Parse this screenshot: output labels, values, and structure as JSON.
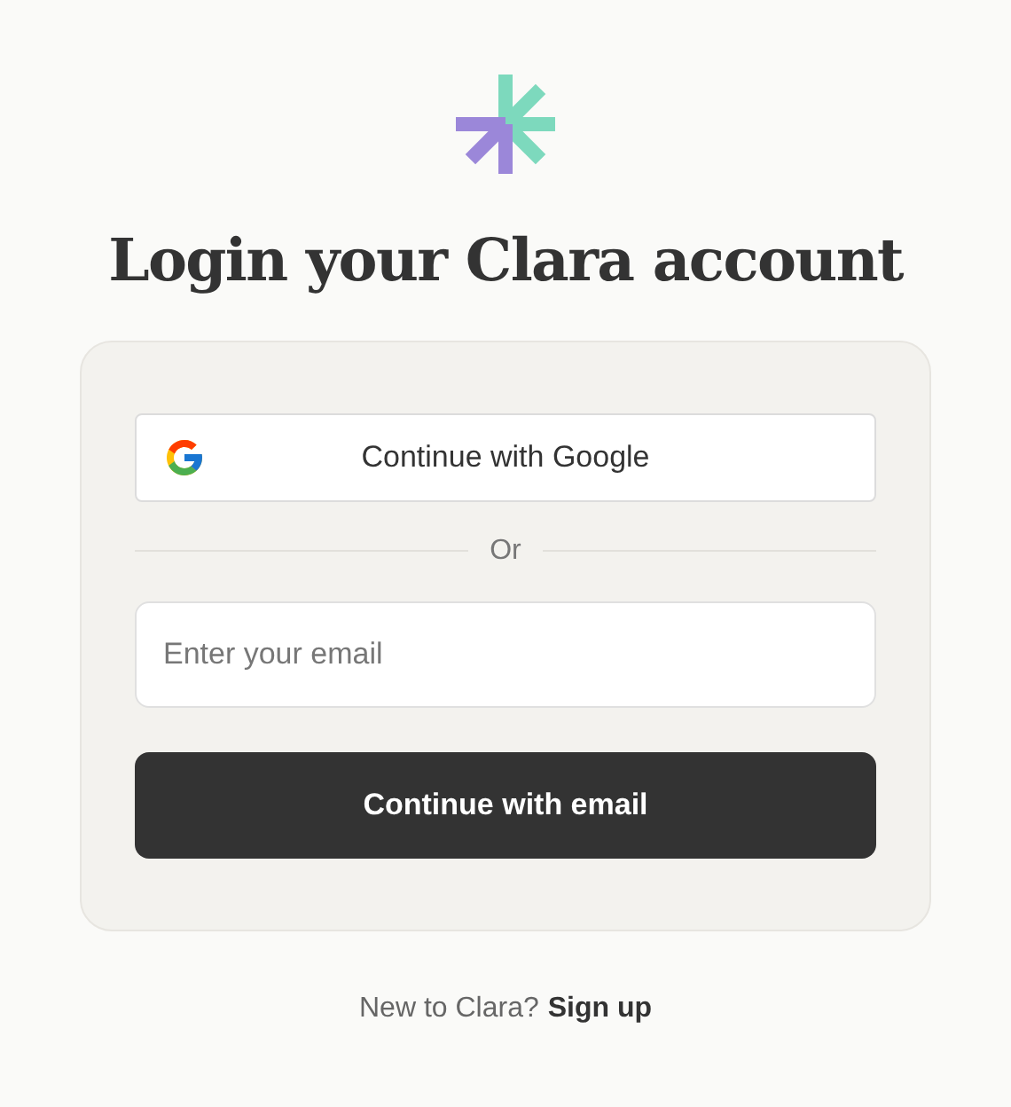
{
  "title": "Login your Clara account",
  "google_button": {
    "label": "Continue with Google"
  },
  "divider": {
    "label": "Or"
  },
  "email_field": {
    "placeholder": "Enter your email"
  },
  "email_button": {
    "label": "Continue with email"
  },
  "footer": {
    "text": "New to Clara?",
    "link": "Sign up"
  }
}
